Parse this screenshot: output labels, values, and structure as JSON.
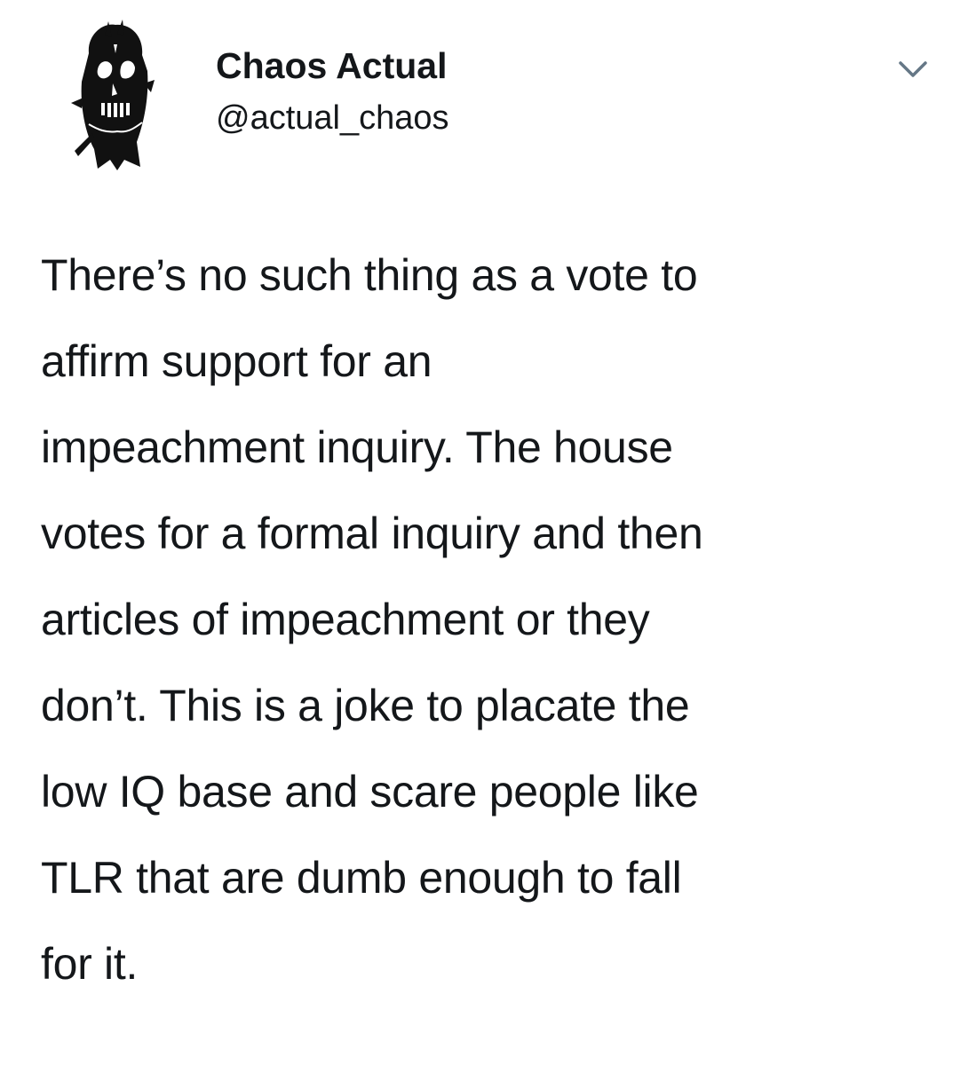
{
  "tweet": {
    "display_name": "Chaos Actual",
    "handle": "@actual_chaos",
    "text_lines": [
      "There’s no such thing as a vote to",
      "affirm support for an",
      "impeachment inquiry. The house",
      "votes for a formal inquiry and then",
      "articles of impeachment or they",
      "don’t. This is a joke to placate the",
      "low IQ base and scare people like",
      "TLR that are dumb enough to fall",
      "for it."
    ],
    "avatar_icon": "skull-avatar-icon",
    "menu_icon": "chevron-down-icon"
  },
  "colors": {
    "background": "#ffffff",
    "text": "#14171a",
    "caret": "#657786"
  }
}
